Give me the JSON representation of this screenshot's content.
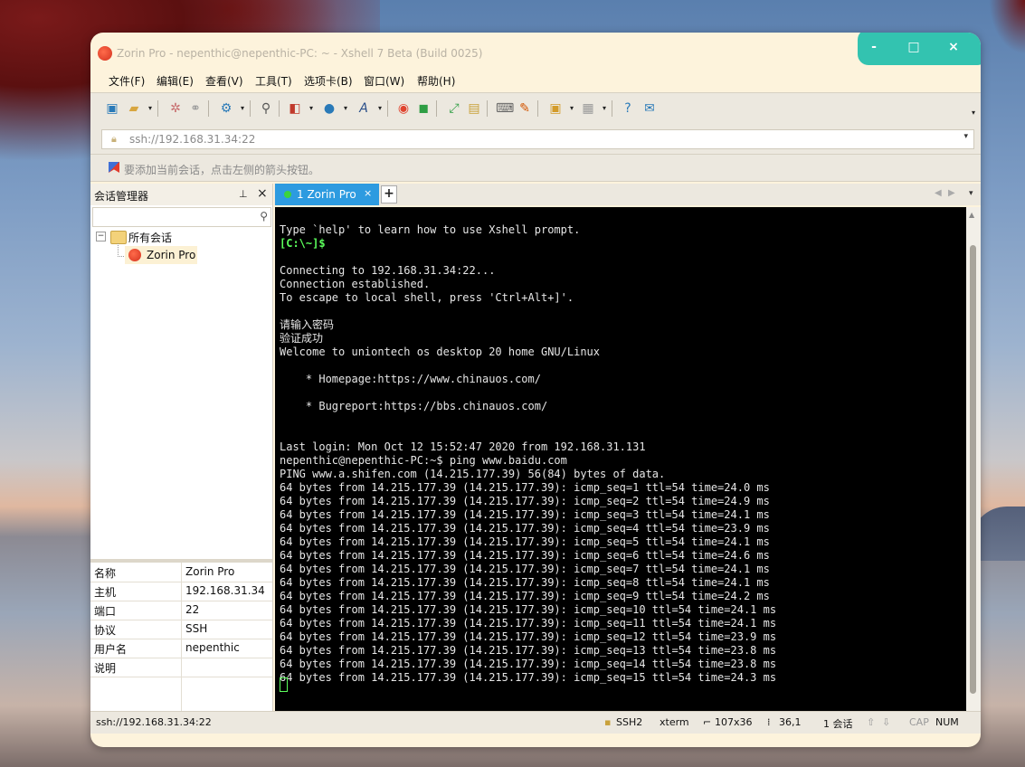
{
  "window": {
    "title": "Zorin Pro - nepenthic@nepenthic-PC: ~ - Xshell 7 Beta (Build 0025)",
    "controls": {
      "minimize": "-",
      "maximize": "□",
      "close": "×"
    },
    "accent_color": "#33c3b0"
  },
  "menu": [
    "文件(F)",
    "编辑(E)",
    "查看(V)",
    "工具(T)",
    "选项卡(B)",
    "窗口(W)",
    "帮助(H)"
  ],
  "address": {
    "value": "ssh://192.168.31.34:22"
  },
  "hint": "要添加当前会话，点击左侧的箭头按钮。",
  "session_manager": {
    "title": "会话管理器",
    "root": "所有会话",
    "child": "Zorin Pro",
    "properties": [
      {
        "key": "名称",
        "value": "Zorin Pro"
      },
      {
        "key": "主机",
        "value": "192.168.31.34"
      },
      {
        "key": "端口",
        "value": "22"
      },
      {
        "key": "协议",
        "value": "SSH"
      },
      {
        "key": "用户名",
        "value": "nepenthic"
      },
      {
        "key": "说明",
        "value": ""
      }
    ]
  },
  "tab": {
    "label": "1 Zorin Pro",
    "add": "+"
  },
  "terminal": {
    "lines": [
      "Type `help' to learn how to use Xshell prompt.",
      "[C:\\~]$",
      "",
      "Connecting to 192.168.31.34:22...",
      "Connection established.",
      "To escape to local shell, press 'Ctrl+Alt+]'.",
      "",
      "请输入密码",
      "验证成功",
      "Welcome to uniontech os desktop 20 home GNU/Linux",
      "",
      "    * Homepage:https://www.chinauos.com/",
      "",
      "    * Bugreport:https://bbs.chinauos.com/",
      "",
      "",
      "Last login: Mon Oct 12 15:52:47 2020 from 192.168.31.131",
      "nepenthic@nepenthic-PC:~$ ping www.baidu.com",
      "PING www.a.shifen.com (14.215.177.39) 56(84) bytes of data.",
      "64 bytes from 14.215.177.39 (14.215.177.39): icmp_seq=1 ttl=54 time=24.0 ms",
      "64 bytes from 14.215.177.39 (14.215.177.39): icmp_seq=2 ttl=54 time=24.9 ms",
      "64 bytes from 14.215.177.39 (14.215.177.39): icmp_seq=3 ttl=54 time=24.1 ms",
      "64 bytes from 14.215.177.39 (14.215.177.39): icmp_seq=4 ttl=54 time=23.9 ms",
      "64 bytes from 14.215.177.39 (14.215.177.39): icmp_seq=5 ttl=54 time=24.1 ms",
      "64 bytes from 14.215.177.39 (14.215.177.39): icmp_seq=6 ttl=54 time=24.6 ms",
      "64 bytes from 14.215.177.39 (14.215.177.39): icmp_seq=7 ttl=54 time=24.1 ms",
      "64 bytes from 14.215.177.39 (14.215.177.39): icmp_seq=8 ttl=54 time=24.1 ms",
      "64 bytes from 14.215.177.39 (14.215.177.39): icmp_seq=9 ttl=54 time=24.2 ms",
      "64 bytes from 14.215.177.39 (14.215.177.39): icmp_seq=10 ttl=54 time=24.1 ms",
      "64 bytes from 14.215.177.39 (14.215.177.39): icmp_seq=11 ttl=54 time=24.1 ms",
      "64 bytes from 14.215.177.39 (14.215.177.39): icmp_seq=12 ttl=54 time=23.9 ms",
      "64 bytes from 14.215.177.39 (14.215.177.39): icmp_seq=13 ttl=54 time=23.8 ms",
      "64 bytes from 14.215.177.39 (14.215.177.39): icmp_seq=14 ttl=54 time=23.8 ms",
      "64 bytes from 14.215.177.39 (14.215.177.39): icmp_seq=15 ttl=54 time=24.3 ms"
    ]
  },
  "status": {
    "address": "ssh://192.168.31.34:22",
    "protocol": "SSH2",
    "term": "xterm",
    "size": "107x36",
    "cursor": "36,1",
    "sessions": "1 会话",
    "cap": "CAP",
    "num": "NUM"
  }
}
